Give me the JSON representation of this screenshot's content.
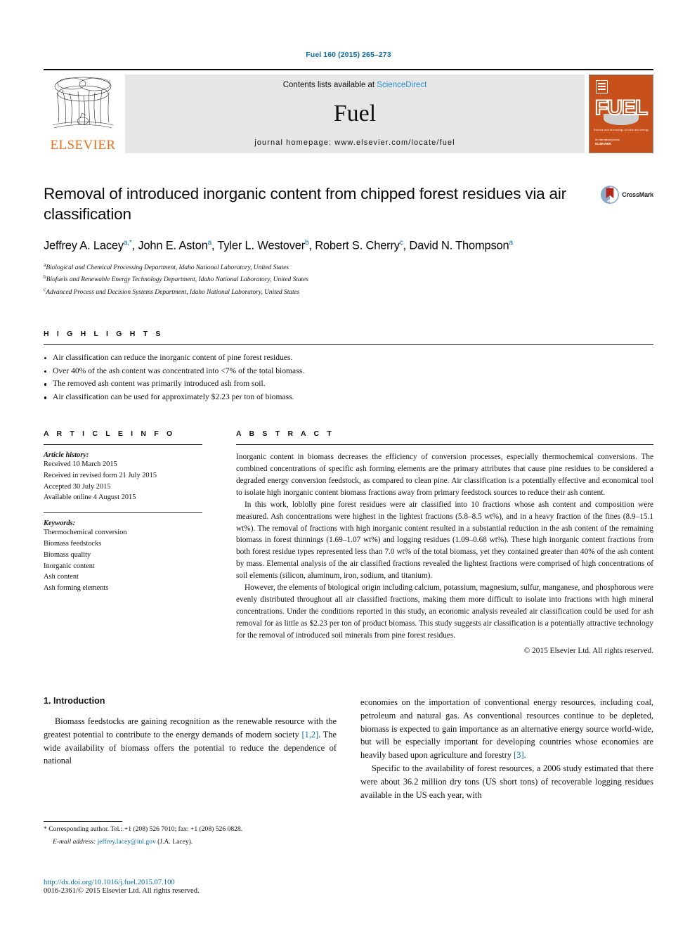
{
  "running_head": "Fuel 160 (2015) 265–273",
  "masthead": {
    "publisher": "ELSEVIER",
    "contents_prefix": "Contents lists available at ",
    "contents_link": "ScienceDirect",
    "journal_name": "Fuel",
    "homepage": "journal homepage: www.elsevier.com/locate/fuel",
    "cover": {
      "wordmark": "FUEL",
      "tagline": "Science and technology of fuels and energy",
      "footer_small": "An international journal",
      "footer_bold": "ELSEVIER"
    }
  },
  "article": {
    "title": "Removal of introduced inorganic content from chipped forest residues via air classification",
    "crossmark_label": "CrossMark",
    "authors_html": "Jeffrey A. Lacey<sup>a,</sup><sup>*</sup>, John E. Aston<sup>a</sup>, Tyler L. Westover<sup>b</sup>, Robert S. Cherry<sup>c</sup>, David N. Thompson<sup>a</sup>",
    "affiliations": [
      {
        "marker": "a",
        "text": "Biological and Chemical Processing Department, Idaho National Laboratory, United States"
      },
      {
        "marker": "b",
        "text": "Biofuels and Renewable Energy Technology Department, Idaho National Laboratory, United States"
      },
      {
        "marker": "c",
        "text": "Advanced Process and Decision Systems Department, Idaho National Laboratory, United States"
      }
    ]
  },
  "highlights": {
    "heading": "H I G H L I G H T S",
    "items": [
      "Air classification can reduce the inorganic content of pine forest residues.",
      "Over 40% of the ash content was concentrated into <7% of the total biomass.",
      "The removed ash content was primarily introduced ash from soil.",
      "Air classification can be used for approximately $2.23 per ton of biomass."
    ]
  },
  "article_info": {
    "heading": "A R T I C L E    I N F O",
    "history_label": "Article history:",
    "history": [
      "Received 10 March 2015",
      "Received in revised form 21 July 2015",
      "Accepted 30 July 2015",
      "Available online 4 August 2015"
    ],
    "keywords_label": "Keywords:",
    "keywords": [
      "Thermochemical conversion",
      "Biomass feedstocks",
      "Biomass quality",
      "Inorganic content",
      "Ash content",
      "Ash forming elements"
    ]
  },
  "abstract": {
    "heading": "A B S T R A C T",
    "paragraphs": [
      "Inorganic content in biomass decreases the efficiency of conversion processes, especially thermochemical conversions. The combined concentrations of specific ash forming elements are the primary attributes that cause pine residues to be considered a degraded energy conversion feedstock, as compared to clean pine. Air classification is a potentially effective and economical tool to isolate high inorganic content biomass fractions away from primary feedstock sources to reduce their ash content.",
      "In this work, loblolly pine forest residues were air classified into 10 fractions whose ash content and composition were measured. Ash concentrations were highest in the lightest fractions (5.8–8.5 wt%), and in a heavy fraction of the fines (8.9–15.1 wt%). The removal of fractions with high inorganic content resulted in a substantial reduction in the ash content of the remaining biomass in forest thinnings (1.69–1.07 wt%) and logging residues (1.09–0.68 wt%). These high inorganic content fractions from both forest residue types represented less than 7.0 wt% of the total biomass, yet they contained greater than 40% of the ash content by mass. Elemental analysis of the air classified fractions revealed the lightest fractions were comprised of high concentrations of soil elements (silicon, aluminum, iron, sodium, and titanium).",
      "However, the elements of biological origin including calcium, potassium, magnesium, sulfur, manganese, and phosphorous were evenly distributed throughout all air classified fractions, making them more difficult to isolate into fractions with high mineral concentrations. Under the conditions reported in this study, an economic analysis revealed air classification could be used for ash removal for as little as $2.23 per ton of product biomass. This study suggests air classification is a potentially attractive technology for the removal of introduced soil minerals from pine forest residues."
    ],
    "copyright": "© 2015 Elsevier Ltd. All rights reserved."
  },
  "body": {
    "section_heading": "1. Introduction",
    "left_paragraph_pre": "Biomass feedstocks are gaining recognition as the renewable resource with the greatest potential to contribute to the energy demands of modern society ",
    "left_ref_1": "[1,2]",
    "left_paragraph_post": ". The wide availability of biomass offers the potential to reduce the dependence of national",
    "right_paragraph_pre": "economies on the importation of conventional energy resources, including coal, petroleum and natural gas. As conventional resources continue to be depleted, biomass is expected to gain importance as an alternative energy source world-wide, but will be especially important for developing countries whose economies are heavily based upon agriculture and forestry ",
    "right_ref_3": "[3]",
    "right_paragraph_post": ".",
    "right_paragraph_2": "Specific to the availability of forest resources, a 2006 study estimated that there were about 36.2 million dry tons (US short tons) of recoverable logging residues available in the US each year, with"
  },
  "footer": {
    "corresponding_marker": "*",
    "corresponding_text": "Corresponding author. Tel.: +1 (208) 526 7010; fax: +1 (208) 526 0828.",
    "email_label": "E-mail address:",
    "email": "jeffrey.lacey@inl.gov",
    "email_owner": "(J.A. Lacey).",
    "doi": "http://dx.doi.org/10.1016/j.fuel.2015.07.100",
    "issn": "0016-2361/© 2015 Elsevier Ltd. All rights reserved."
  },
  "colors": {
    "link_blue": "#0a6ca2",
    "sciencedirect_blue": "#2b8fd1",
    "elsevier_orange": "#E9711C",
    "cover_orange": "#C8511B",
    "crossmark_red": "#B5281E"
  }
}
